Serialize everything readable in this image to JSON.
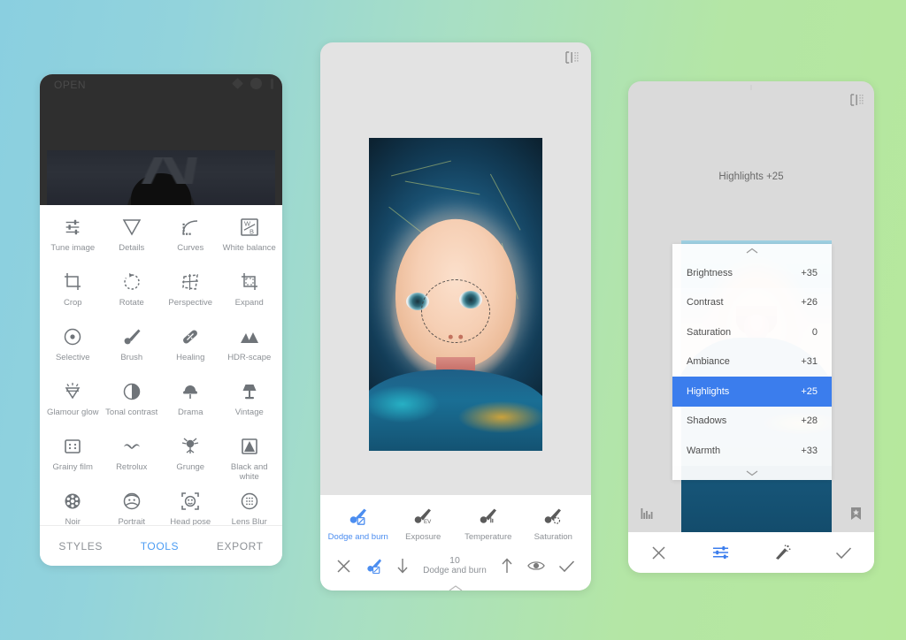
{
  "background": {
    "from": "#8ACFE0",
    "to": "#B6E89C"
  },
  "accent": "#4b9cf3",
  "selected_row_color": "#3b7ded",
  "panel_tools": {
    "name": "tools-screen",
    "status": {
      "open_label": "OPEN"
    },
    "grid_items": [
      {
        "label": "Tune image",
        "icon": "tune-image-icon"
      },
      {
        "label": "Details",
        "icon": "details-icon"
      },
      {
        "label": "Curves",
        "icon": "curves-icon"
      },
      {
        "label": "White balance",
        "icon": "white-balance-icon"
      },
      {
        "label": "Crop",
        "icon": "crop-icon"
      },
      {
        "label": "Rotate",
        "icon": "rotate-icon"
      },
      {
        "label": "Perspective",
        "icon": "perspective-icon"
      },
      {
        "label": "Expand",
        "icon": "expand-icon"
      },
      {
        "label": "Selective",
        "icon": "selective-icon"
      },
      {
        "label": "Brush",
        "icon": "brush-icon"
      },
      {
        "label": "Healing",
        "icon": "healing-icon"
      },
      {
        "label": "HDR-scape",
        "icon": "hdr-scape-icon"
      },
      {
        "label": "Glamour glow",
        "icon": "glamour-glow-icon"
      },
      {
        "label": "Tonal contrast",
        "icon": "tonal-contrast-icon"
      },
      {
        "label": "Drama",
        "icon": "drama-icon"
      },
      {
        "label": "Vintage",
        "icon": "vintage-icon"
      },
      {
        "label": "Grainy film",
        "icon": "grainy-film-icon"
      },
      {
        "label": "Retrolux",
        "icon": "retrolux-icon"
      },
      {
        "label": "Grunge",
        "icon": "grunge-icon"
      },
      {
        "label": "Black and white",
        "icon": "black-and-white-icon"
      },
      {
        "label": "Noir",
        "icon": "noir-icon"
      },
      {
        "label": "Portrait",
        "icon": "portrait-icon"
      },
      {
        "label": "Head pose",
        "icon": "head-pose-icon"
      },
      {
        "label": "Lens Blur",
        "icon": "lens-blur-icon"
      }
    ],
    "tabs": [
      {
        "label": "STYLES",
        "active": false
      },
      {
        "label": "TOOLS",
        "active": true
      },
      {
        "label": "EXPORT",
        "active": false
      }
    ]
  },
  "panel_edit": {
    "name": "edit-screen",
    "compare_icon": "compare-icon",
    "tools": [
      {
        "label": "Dodge and burn",
        "icon": "dodge-and-burn-icon",
        "active": true
      },
      {
        "label": "Exposure",
        "icon": "exposure-brush-icon",
        "active": false
      },
      {
        "label": "Temperature",
        "icon": "temperature-brush-icon",
        "active": false
      },
      {
        "label": "Saturation",
        "icon": "saturation-brush-icon",
        "active": false
      }
    ],
    "action_bar": {
      "cancel_icon": "close-icon",
      "brush_icon": "dodge-and-burn-icon",
      "decrease_icon": "arrow-down-icon",
      "amount_value": "10",
      "amount_label": "Dodge and burn",
      "increase_icon": "arrow-up-icon",
      "mask_icon": "eye-icon",
      "apply_icon": "check-icon"
    }
  },
  "panel_adjust": {
    "name": "adjust-screen",
    "title": "Highlights +25",
    "compare_icon": "compare-icon",
    "list_items": [
      {
        "label": "Brightness",
        "value": "+35",
        "selected": false
      },
      {
        "label": "Contrast",
        "value": "+26",
        "selected": false
      },
      {
        "label": "Saturation",
        "value": "0",
        "selected": false
      },
      {
        "label": "Ambiance",
        "value": "+31",
        "selected": false
      },
      {
        "label": "Highlights",
        "value": "+25",
        "selected": true
      },
      {
        "label": "Shadows",
        "value": "+28",
        "selected": false
      },
      {
        "label": "Warmth",
        "value": "+33",
        "selected": false
      }
    ],
    "meta": {
      "histogram_icon": "histogram-icon",
      "bookmark_icon": "bookmark-star-icon"
    },
    "action_bar": {
      "cancel_icon": "close-icon",
      "sliders_icon": "sliders-icon",
      "auto_icon": "magic-wand-icon",
      "apply_icon": "check-icon"
    }
  }
}
